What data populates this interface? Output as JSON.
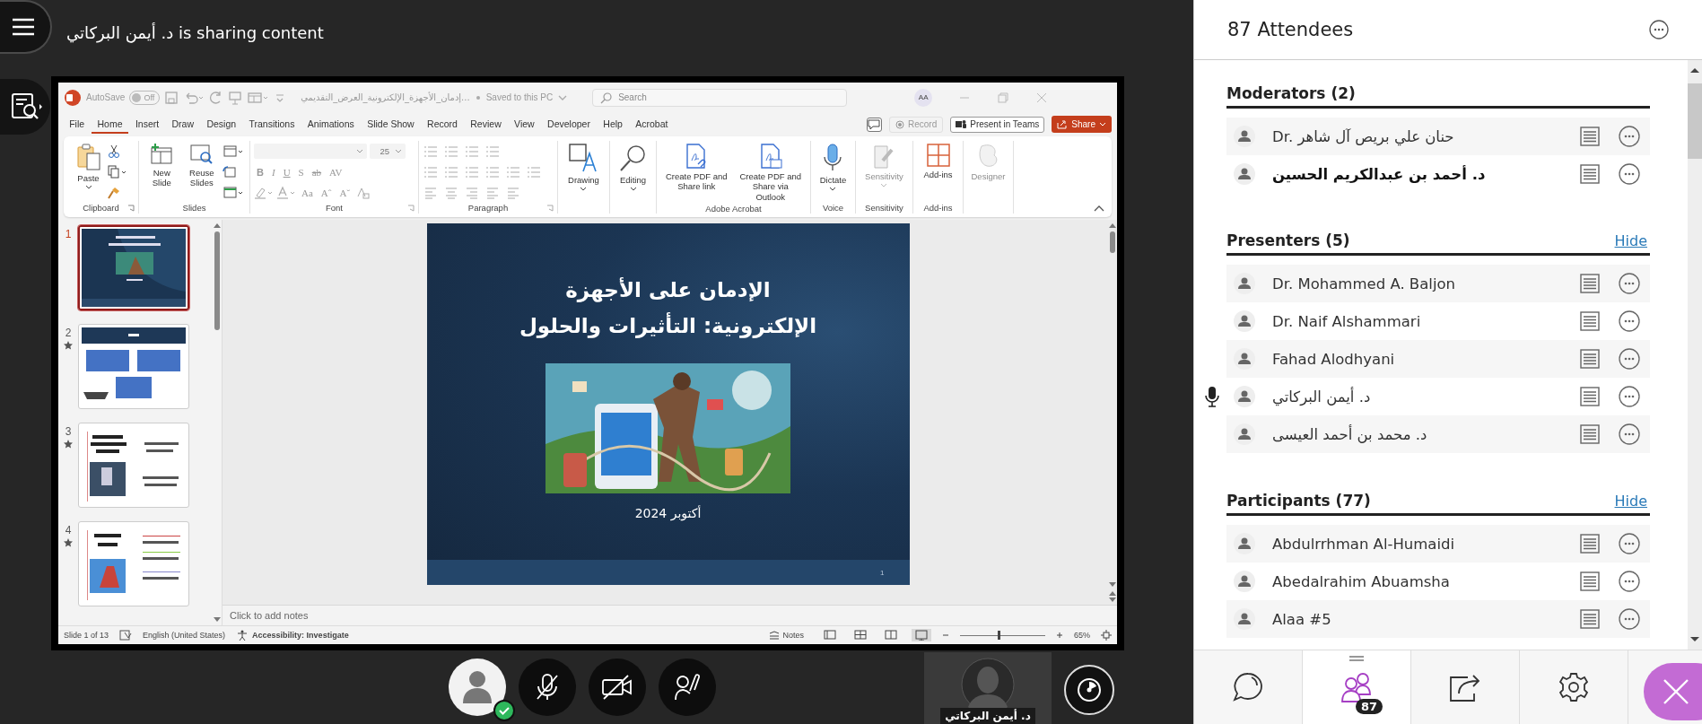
{
  "top_bar": {
    "sharing_text": "د. أيمن البركاتي is sharing content"
  },
  "powerpoint": {
    "title_bar": {
      "autosave_label": "AutoSave",
      "autosave_on": false,
      "autosave_state": "Off",
      "file_name": "...إدمان_الأجهزة_الإلكترونية_العرض_التقديمي",
      "save_status": "Saved to this PC",
      "search_placeholder": "Search",
      "user_initials": "AA"
    },
    "tabs": [
      {
        "label": "File",
        "selected": false
      },
      {
        "label": "Home",
        "selected": true
      },
      {
        "label": "Insert",
        "selected": false
      },
      {
        "label": "Draw",
        "selected": false
      },
      {
        "label": "Design",
        "selected": false
      },
      {
        "label": "Transitions",
        "selected": false
      },
      {
        "label": "Animations",
        "selected": false
      },
      {
        "label": "Slide Show",
        "selected": false
      },
      {
        "label": "Record",
        "selected": false
      },
      {
        "label": "Review",
        "selected": false
      },
      {
        "label": "View",
        "selected": false
      },
      {
        "label": "Developer",
        "selected": false
      },
      {
        "label": "Help",
        "selected": false
      },
      {
        "label": "Acrobat",
        "selected": false
      }
    ],
    "record": {
      "label": "Record",
      "disabled": true
    },
    "present_in_teams": "Present in Teams",
    "share": "Share",
    "ribbon": {
      "clipboard": {
        "label": "Clipboard",
        "paste": "Paste"
      },
      "slides": {
        "label": "Slides",
        "new_slide": "New Slide",
        "reuse_slides": "Reuse Slides"
      },
      "font": {
        "label": "Font",
        "size": "25",
        "styles": [
          "B",
          "I",
          "U",
          "S",
          "ab",
          "AV"
        ],
        "case": "Aa",
        "grow": "Aˆ",
        "shrink": "Aˇ"
      },
      "paragraph": {
        "label": "Paragraph"
      },
      "drawing": {
        "command": "Drawing"
      },
      "editing": {
        "command": "Editing"
      },
      "acrobat": {
        "label": "Adobe Acrobat",
        "commands": [
          "Create PDF and Share link",
          "Create PDF and Share via Outlook"
        ]
      },
      "voice": {
        "label": "Voice",
        "dictate": "Dictate"
      },
      "sensitivity": {
        "label": "Sensitivity",
        "command": "Sensitivity",
        "disabled": true
      },
      "addins": {
        "label": "Add-ins",
        "command": "Add-ins"
      },
      "designer": {
        "command": "Designer",
        "disabled": true
      }
    },
    "thumbnails": [
      {
        "number": "1",
        "selected": true,
        "animated": false
      },
      {
        "number": "2",
        "selected": false,
        "animated": true
      },
      {
        "number": "3",
        "selected": false,
        "animated": true
      },
      {
        "number": "4",
        "selected": false,
        "animated": true
      }
    ],
    "slide": {
      "title_lines": [
        "الإدمان على الأجهزة",
        "الإلكترونية: التأثيرات والحلول"
      ],
      "date": "أكتوبر 2024",
      "page_number": "1"
    },
    "notes_placeholder": "Click to add notes",
    "status_bar": {
      "slide_position": "Slide 1 of 13",
      "language": "English (United States)",
      "accessibility": "Accessibility: Investigate",
      "notes": "Notes",
      "view_buttons": [
        {
          "selected": false
        },
        {
          "selected": false
        },
        {
          "selected": false
        },
        {
          "selected": true
        }
      ],
      "zoom": {
        "level": 0.45,
        "reading": "65%"
      }
    }
  },
  "call_controls": {
    "mic_muted": true,
    "camera_on": false
  },
  "video_tile": {
    "name": "د. أيمن البركاتي"
  },
  "attendees_panel": {
    "title": "87 Attendees",
    "sections": [
      {
        "title": "Moderators (2)",
        "people": [
          {
            "name": "Dr. حنان علي بريص آل شاهر",
            "bold": false,
            "talking": false
          },
          {
            "name": "د. أحمد بن عبدالكريم الحسين",
            "bold": true,
            "talking": false
          }
        ]
      },
      {
        "title": "Presenters (5)",
        "hide_label": "Hide",
        "people": [
          {
            "name": "Dr. Mohammed A. Baljon",
            "bold": false,
            "talking": false
          },
          {
            "name": "Dr. Naif Alshammari",
            "bold": false,
            "talking": false
          },
          {
            "name": "Fahad Alodhyani",
            "bold": false,
            "talking": false
          },
          {
            "name": "د. أيمن البركاتي",
            "bold": false,
            "talking": true
          },
          {
            "name": "د. محمد بن أحمد العيسى",
            "bold": false,
            "talking": false
          }
        ]
      },
      {
        "title": "Participants (77)",
        "hide_label": "Hide",
        "people": [
          {
            "name": "Abdulrrhman Al-Humaidi",
            "bold": false,
            "talking": false
          },
          {
            "name": "Abedalrahim Abuamsha",
            "bold": false,
            "talking": false
          },
          {
            "name": "Alaa #5",
            "bold": false,
            "talking": false
          }
        ]
      }
    ],
    "nav": [
      {
        "kind": "chat",
        "selected": false
      },
      {
        "kind": "attendees",
        "selected": true,
        "badge": "87"
      },
      {
        "kind": "share",
        "selected": false
      },
      {
        "kind": "settings",
        "selected": false
      }
    ]
  }
}
